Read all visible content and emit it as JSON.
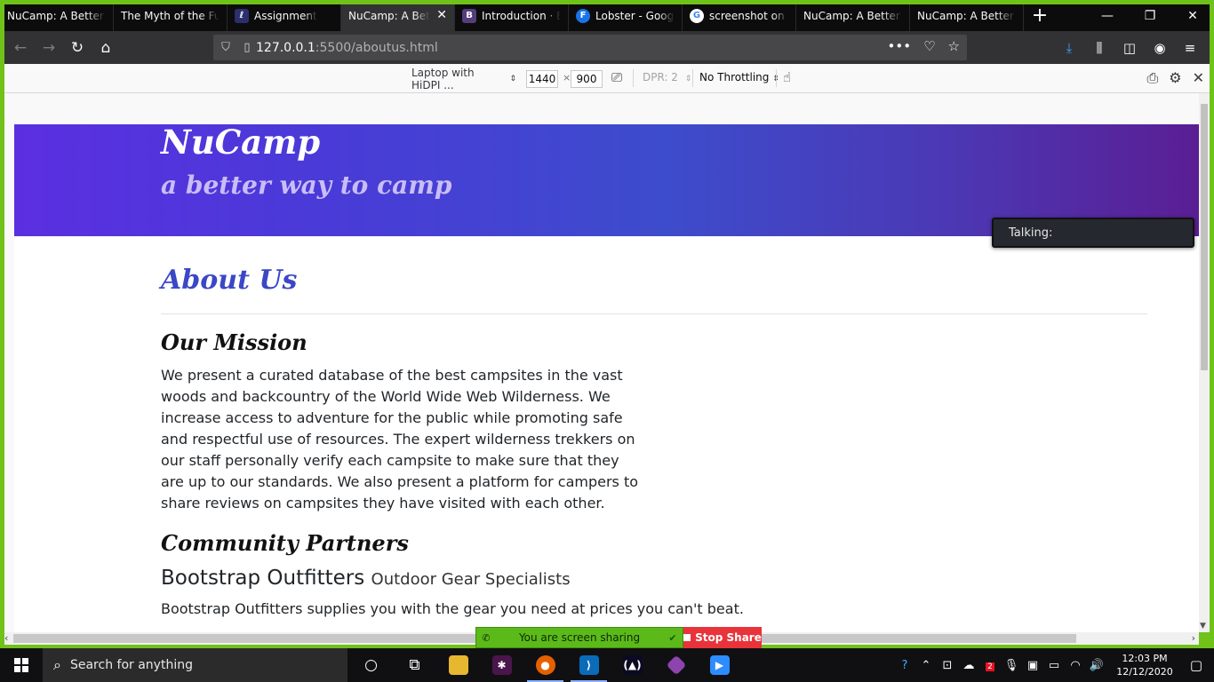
{
  "browser": {
    "tabs": [
      {
        "label": "NuCamp: A Better W",
        "favicon": "",
        "active": false
      },
      {
        "label": "The Myth of the Full-",
        "favicon": "",
        "active": false
      },
      {
        "label": "Assignment",
        "favicon": "nucamp-icon",
        "active": false
      },
      {
        "label": "NuCamp: A Better W",
        "favicon": "",
        "active": true
      },
      {
        "label": "Introduction · Bo",
        "favicon": "bootstrap-icon",
        "active": false
      },
      {
        "label": "Lobster - Google",
        "favicon": "google-fonts-icon",
        "active": false
      },
      {
        "label": "screenshot on w",
        "favicon": "google-icon",
        "active": false
      },
      {
        "label": "NuCamp: A Better W",
        "favicon": "",
        "active": false
      },
      {
        "label": "NuCamp: A Better W",
        "favicon": "",
        "active": false
      }
    ],
    "url_host": "127.0.0.1",
    "url_path": ":5500/aboutus.html"
  },
  "rdm": {
    "device": "Laptop with HiDPI ...",
    "width": "1440",
    "height": "900",
    "times": "×",
    "dpr": "DPR: 2",
    "throttling": "No Throttling"
  },
  "site": {
    "title": "NuCamp",
    "tagline": "a better way to camp",
    "about_heading": "About Us",
    "mission_heading": "Our Mission",
    "mission_text": "We present a curated database of the best campsites in the vast woods and backcountry of the World Wide Web Wilderness. We increase access to adventure for the public while promoting safe and respectful use of resources. The expert wilderness trekkers on our staff personally verify each campsite to make sure that they are up to our standards. We also present a platform for campers to share reviews on campsites they have visited with each other.",
    "partners_heading": "Community Partners",
    "partner_name": "Bootstrap Outfitters",
    "partner_subtitle": "Outdoor Gear Specialists",
    "partner_desc": "Bootstrap Outfitters supplies you with the gear you need at prices you can't beat."
  },
  "overlay": {
    "talking_label": "Talking:"
  },
  "screen_share": {
    "status": "You are screen sharing",
    "stop_label": "Stop Share"
  },
  "taskbar": {
    "search_placeholder": "Search for anything",
    "time": "12:03 PM",
    "date": "12/12/2020",
    "badge_count": "2"
  },
  "colors": {
    "share_green": "#6fc219",
    "heading_blue": "#3b47c7",
    "stop_red": "#e8333a"
  }
}
